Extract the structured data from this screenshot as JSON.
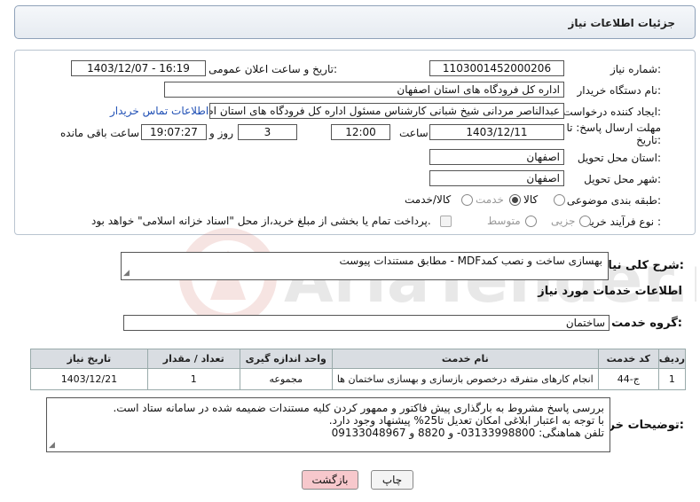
{
  "header": {
    "title": "جزئیات اطلاعات نیاز"
  },
  "form": {
    "need_number_label": "شماره نیاز:",
    "need_number": "1103001452000206",
    "announce_label": "تاریخ و ساعت اعلان عمومی:",
    "announce_value": "1403/12/07 - 16:19",
    "buyer_org_label": "نام دستگاه خریدار:",
    "buyer_org": "اداره کل فرودگاه های استان اصفهان",
    "requester_label": "ایجاد کننده درخواست:",
    "requester": "عبدالناصر مردانی شیخ شبانی کارشناس مسئول  اداره کل فرودگاه های استان اصفهان",
    "contact_link": "اطلاعات تماس خریدار",
    "deadline_label": "مهلت ارسال پاسخ: تا تاریخ:",
    "deadline_date": "1403/12/11",
    "time_label": "ساعت",
    "deadline_time": "12:00",
    "days_value": "3",
    "days_label": "روز و",
    "remaining_time": "19:07:27",
    "remaining_label": "ساعت باقی مانده",
    "province_label": "استان محل تحویل:",
    "province": "اصفهان",
    "city_label": "شهر محل تحویل:",
    "city": "اصفهان",
    "category_label": "طبقه بندی موضوعی:",
    "category_options": [
      "کالا",
      "خدمت",
      "کالا/خدمت"
    ],
    "category_selected": "خدمت",
    "process_label": "نوع فرآیند خرید :",
    "process_options": [
      "جزیی",
      "متوسط"
    ],
    "payment_note": "پرداخت تمام یا بخشی از مبلغ خرید،از محل \"اسناد خزانه اسلامی\" خواهد بود."
  },
  "summary": {
    "label": "شرح کلی نیاز:",
    "text": "بهسازی ساخت و نصب کمدMDF   - مطابق مستندات پیوست"
  },
  "services": {
    "title": "اطلاعات خدمات مورد نیاز",
    "group_label": "گروه خدمت:",
    "group_value": "ساختمان",
    "columns": [
      "ردیف",
      "کد خدمت",
      "نام خدمت",
      "واحد اندازه گیری",
      "تعداد / مقدار",
      "تاریخ نیاز"
    ],
    "rows": [
      [
        "1",
        "ج-44",
        "انجام کارهای متفرقه درخصوص بازسازی و بهسازی ساختمان ها",
        "مجموعه",
        "1",
        "1403/12/21"
      ]
    ]
  },
  "buyer_notes": {
    "label": "توضیحات خریدار:",
    "lines": [
      "بررسی پاسخ مشروط  به بارگذاری پیش فاکتور و ممهور کردن کلیه مستندات ضمیمه شده در سامانه  ستاد است.",
      "با توجه به اعتبار ابلاغی امکان تعدیل تا25% پیشنهاد وجود دارد.",
      "تلفن هماهنگی:  03133998800-  و 8820 و 09133048967"
    ]
  },
  "buttons": {
    "print": "چاپ",
    "back": "بازگشت"
  },
  "watermark_text": "AriaTender.neT",
  "colors": {
    "link": "#1f4fb5",
    "back_button": "#f7c8cc",
    "watermark": "#c0392b"
  }
}
